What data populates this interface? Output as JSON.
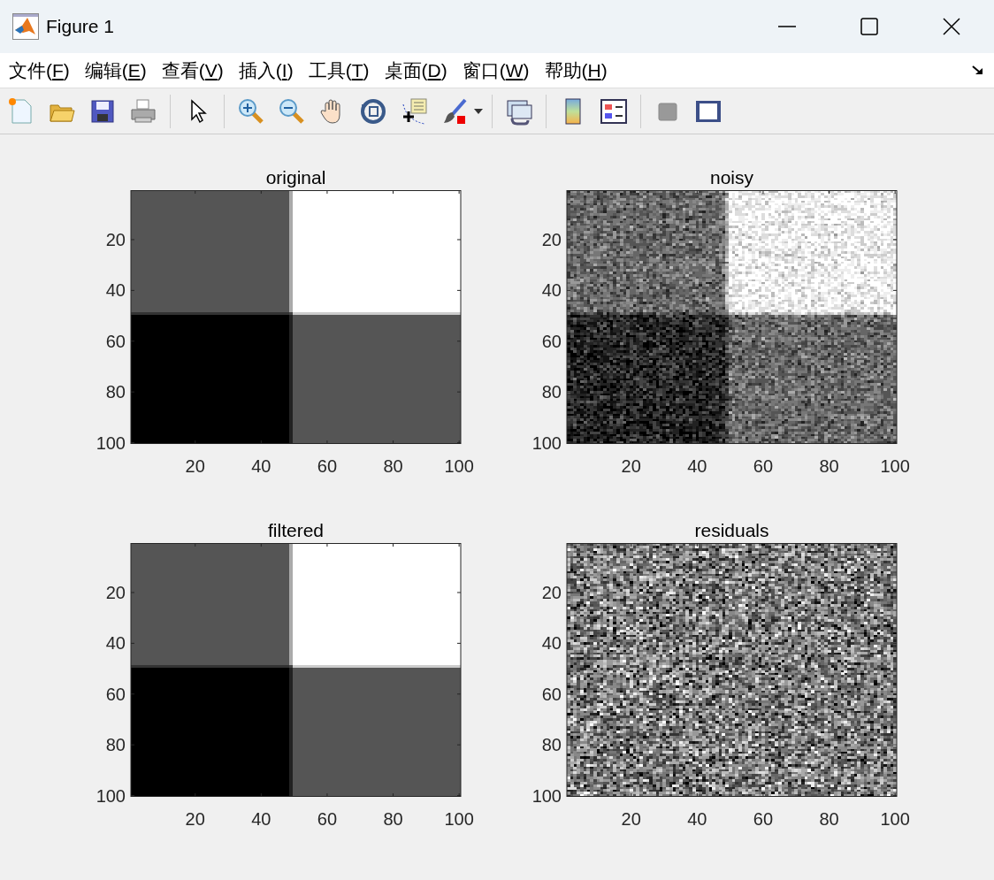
{
  "window": {
    "title": "Figure 1"
  },
  "menu": [
    {
      "label": "文件(F)"
    },
    {
      "label": "编辑(E)"
    },
    {
      "label": "查看(V)"
    },
    {
      "label": "插入(I)"
    },
    {
      "label": "工具(T)"
    },
    {
      "label": "桌面(D)"
    },
    {
      "label": "窗口(W)"
    },
    {
      "label": "帮助(H)"
    }
  ],
  "plots": [
    {
      "title": "original",
      "kind": "blocks",
      "yticks": [
        "20",
        "40",
        "60",
        "80",
        "100"
      ],
      "xticks": [
        "20",
        "40",
        "60",
        "80",
        "100"
      ]
    },
    {
      "title": "noisy",
      "kind": "noisy-blocks",
      "yticks": [
        "20",
        "40",
        "60",
        "80",
        "100"
      ],
      "xticks": [
        "20",
        "40",
        "60",
        "80",
        "100"
      ]
    },
    {
      "title": "filtered",
      "kind": "blocks",
      "yticks": [
        "20",
        "40",
        "60",
        "80",
        "100"
      ],
      "xticks": [
        "20",
        "40",
        "60",
        "80",
        "100"
      ]
    },
    {
      "title": "residuals",
      "kind": "noise",
      "yticks": [
        "20",
        "40",
        "60",
        "80",
        "100"
      ],
      "xticks": [
        "20",
        "40",
        "60",
        "80",
        "100"
      ]
    }
  ]
}
